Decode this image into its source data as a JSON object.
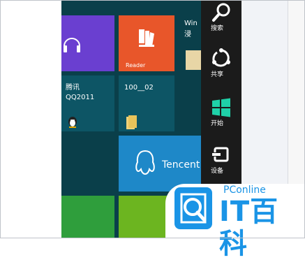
{
  "tiles": {
    "reader": "Reader",
    "windows_partial": "Win",
    "zh_partial": "浸",
    "qq_name": "腾讯",
    "qq_version": "QQ2011",
    "folder": "100__02",
    "tencent": "Tencent"
  },
  "charms": [
    {
      "label": "搜索",
      "icon": "search-icon"
    },
    {
      "label": "共享",
      "icon": "share-icon"
    },
    {
      "label": "开始",
      "icon": "windows-start-icon"
    },
    {
      "label": "设备",
      "icon": "devices-icon"
    }
  ],
  "watermark": {
    "top": "PConline",
    "main": "IT百科",
    "icon": "magnifier-logo"
  },
  "colors": {
    "start_bg": "#0a3f4a",
    "purple_tile": "#6a3fd0",
    "reader_tile": "#e8562a",
    "teal_tile": "#0d5565",
    "tencent_tile": "#1e88c8",
    "green_tile": "#5aa627",
    "charms_bg": "#1b1b1b",
    "brand_blue": "#1a94e6"
  }
}
